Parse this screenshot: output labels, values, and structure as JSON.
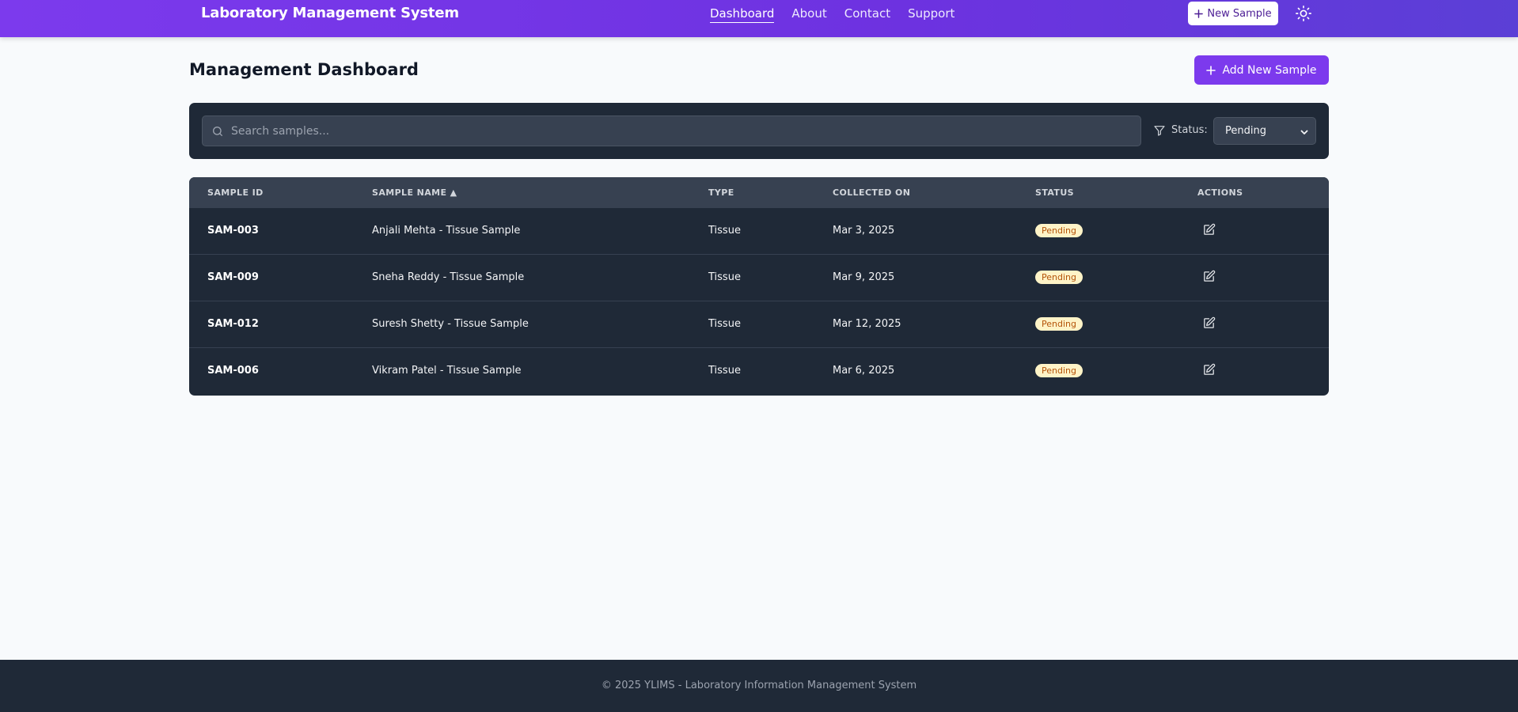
{
  "header": {
    "brand": "Laboratory Management System",
    "nav": [
      "Dashboard",
      "About",
      "Contact",
      "Support"
    ],
    "active_nav": "Dashboard",
    "new_sample_label": "New Sample",
    "theme_icon": "sun-icon",
    "colors": {
      "gradient_start": "#7c3aed",
      "gradient_end": "#5b3fd6"
    }
  },
  "main": {
    "title": "Management Dashboard",
    "add_button_label": "Add New Sample",
    "accent": "#7c3aed"
  },
  "filters": {
    "search_placeholder": "Search samples...",
    "search_value": "",
    "status_label": "Status:",
    "status_value": "Pending"
  },
  "table": {
    "headers": [
      "SAMPLE ID",
      "SAMPLE NAME ▲",
      "TYPE",
      "COLLECTED ON",
      "STATUS",
      "ACTIONS"
    ],
    "rows": [
      {
        "id": "SAM-003",
        "name": "Anjali Mehta - Tissue Sample",
        "type": "Tissue",
        "collected": "Mar 3, 2025",
        "status": "Pending"
      },
      {
        "id": "SAM-009",
        "name": "Sneha Reddy - Tissue Sample",
        "type": "Tissue",
        "collected": "Mar 9, 2025",
        "status": "Pending"
      },
      {
        "id": "SAM-012",
        "name": "Suresh Shetty - Tissue Sample",
        "type": "Tissue",
        "collected": "Mar 12, 2025",
        "status": "Pending"
      },
      {
        "id": "SAM-006",
        "name": "Vikram Patel - Tissue Sample",
        "type": "Tissue",
        "collected": "Mar 6, 2025",
        "status": "Pending"
      }
    ],
    "status_colors": {
      "pending_bg": "#fef3c7",
      "pending_text": "#b45309"
    },
    "action_icon": "edit-icon"
  },
  "footer": {
    "text": "© 2025 YLIMS - Laboratory Information Management System"
  }
}
